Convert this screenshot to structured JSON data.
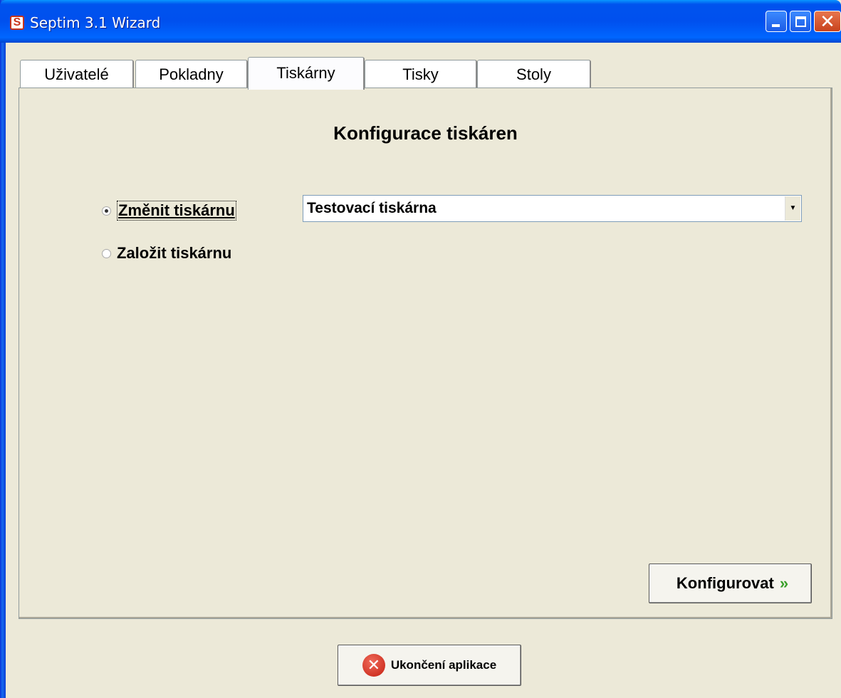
{
  "window": {
    "title": "Septim 3.1 Wizard",
    "app_icon_letter": "S",
    "minimize_label": "_",
    "maximize_label": "□",
    "close_label": "✕"
  },
  "tabs": [
    {
      "label": "Uživatelé"
    },
    {
      "label": "Pokladny"
    },
    {
      "label": "Tiskárny"
    },
    {
      "label": "Tisky"
    },
    {
      "label": "Stoly"
    }
  ],
  "active_tab": "Tiskárny",
  "panel": {
    "heading": "Konfigurace tiskáren",
    "options": [
      {
        "label": "Změnit tiskárnu",
        "checked": true
      },
      {
        "label": "Založit tiskárnu",
        "checked": false
      }
    ],
    "printer_select": {
      "value": "Testovací tiskárna",
      "arrow": "▼"
    },
    "configure_button": {
      "label": "Konfigurovat",
      "chevron": "»"
    }
  },
  "footer": {
    "exit_button": {
      "label": "Ukončení aplikace",
      "icon_glyph": "✕"
    }
  },
  "colors": {
    "titlebar": "#0053EE",
    "background": "#ECE9D8",
    "accent_green": "#3AA02A",
    "exit_red": "#C41F10"
  }
}
